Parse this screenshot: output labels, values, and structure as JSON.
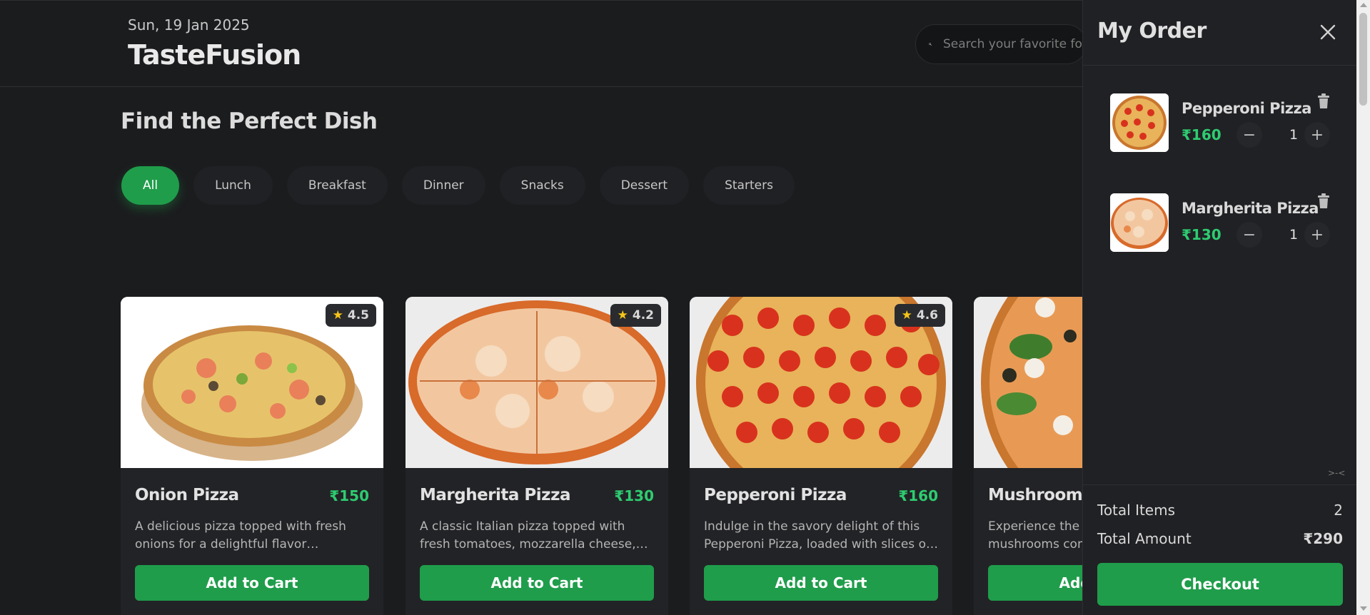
{
  "header": {
    "date": "Sun, 19 Jan 2025",
    "brand": "TasteFusion",
    "search_placeholder": "Search your favorite food"
  },
  "main": {
    "title": "Find the Perfect Dish",
    "categories": [
      "All",
      "Lunch",
      "Breakfast",
      "Dinner",
      "Snacks",
      "Dessert",
      "Starters"
    ],
    "active_category": "All"
  },
  "cards": [
    {
      "name": "Onion Pizza",
      "price": "₹150",
      "rating": "4.5",
      "desc": "A delicious pizza topped with fresh onions for a delightful flavor experience.",
      "button": "Add to Cart"
    },
    {
      "name": "Margherita Pizza",
      "price": "₹130",
      "rating": "4.2",
      "desc": "A classic Italian pizza topped with fresh tomatoes, mozzarella cheese, and basil.",
      "button": "Add to Cart"
    },
    {
      "name": "Pepperoni Pizza",
      "price": "₹160",
      "rating": "4.6",
      "desc": "Indulge in the savory delight of this Pepperoni Pizza, loaded with slices of pepperoni.",
      "button": "Add to Cart"
    },
    {
      "name": "Mushroom Pizza",
      "price": "",
      "rating": "",
      "desc": "Experience the earthy goodness of mushrooms combined with cheese.",
      "button": "Add to Cart"
    }
  ],
  "order": {
    "title": "My Order",
    "items": [
      {
        "name": "Pepperoni Pizza",
        "price": "₹160",
        "qty": "1"
      },
      {
        "name": "Margherita Pizza",
        "price": "₹130",
        "qty": "1"
      }
    ],
    "total_items_label": "Total Items",
    "total_items": "2",
    "total_amount_label": "Total Amount",
    "total_amount": "₹290",
    "checkout": "Checkout"
  },
  "colors": {
    "accent": "#1f9d4b",
    "price": "#2ecc71",
    "background": "#1b1c1e",
    "panel": "#202124"
  }
}
